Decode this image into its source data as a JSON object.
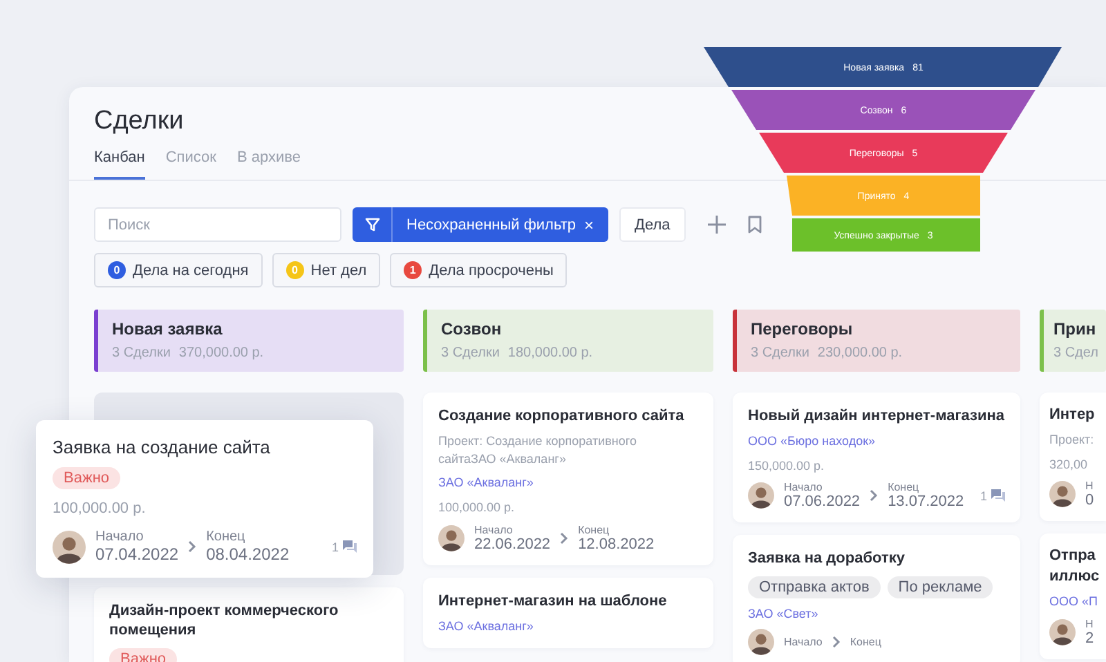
{
  "page": {
    "title": "Сделки"
  },
  "tabs": [
    {
      "label": "Канбан",
      "selected": true
    },
    {
      "label": "Список",
      "selected": false
    },
    {
      "label": "В архиве",
      "selected": false
    }
  ],
  "search": {
    "placeholder": "Поиск"
  },
  "filter": {
    "label": "Несохраненный фильтр",
    "clear": "×"
  },
  "tasks_button": "Дела",
  "chips": [
    {
      "count": "0",
      "label": "Дела на сегодня",
      "color": "#2f5ee0"
    },
    {
      "count": "0",
      "label": "Нет дел",
      "color": "#f5c518"
    },
    {
      "count": "1",
      "label": "Дела просрочены",
      "color": "#e8493f"
    }
  ],
  "funnel": [
    {
      "label": "Новая заявка",
      "count": "81",
      "color": "#2e4f8c"
    },
    {
      "label": "Созвон",
      "count": "6",
      "color": "#9a52b8"
    },
    {
      "label": "Переговоры",
      "count": "5",
      "color": "#e83a5a"
    },
    {
      "label": "Принято",
      "count": "4",
      "color": "#fbb225"
    },
    {
      "label": "Успешно закрытые",
      "count": "3",
      "color": "#6cc02a"
    }
  ],
  "columns": [
    {
      "title": "Новая заявка",
      "deals": "3 Сделки",
      "sum": "370,000.00 р.",
      "color": "#7a3fd0",
      "slot": true,
      "cards": [
        {
          "title": "Дизайн-проект коммерческого помещения",
          "tags": [
            {
              "label": "Важно",
              "kind": "alert"
            }
          ]
        }
      ]
    },
    {
      "title": "Созвон",
      "deals": "3 Сделки",
      "sum": "180,000.00 р.",
      "color": "#7cc04a",
      "cards": [
        {
          "title": "Создание корпоративного сайта",
          "project": "Проект: Создание корпоративного сайтаЗАО «Акваланг»",
          "company": "ЗАО «Акваланг»",
          "amount": "100,000.00 р.",
          "start_label": "Начало",
          "start": "22.06.2022",
          "end_label": "Конец",
          "end": "12.08.2022"
        },
        {
          "title": "Интернет-магазин на шаблоне",
          "company": "ЗАО «Акваланг»"
        }
      ]
    },
    {
      "title": "Переговоры",
      "deals": "3 Сделки",
      "sum": "230,000.00 р.",
      "color": "#c8323a",
      "cards": [
        {
          "title": "Новый дизайн интернет-магазина",
          "company": "ООО «Бюро находок»",
          "amount": "150,000.00 р.",
          "start_label": "Начало",
          "start": "07.06.2022",
          "end_label": "Конец",
          "end": "13.07.2022",
          "comments": "1"
        },
        {
          "title": "Заявка на доработку",
          "tags": [
            {
              "label": "Отправка актов",
              "kind": "plain"
            },
            {
              "label": "По рекламе",
              "kind": "plain"
            }
          ],
          "company": "ЗАО «Свет»",
          "start_label": "Начало",
          "end_label": "Конец"
        }
      ]
    },
    {
      "title": "Прин",
      "deals": "3 Сдел",
      "color": "#7cc04a",
      "cards": [
        {
          "title": "Интер",
          "project": "Проект:",
          "amount": "320,00",
          "start_label": "Н",
          "start": "0"
        },
        {
          "title": "Отпра иллюс",
          "company": "ООО «П",
          "start_label": "Н",
          "start": "2"
        }
      ]
    }
  ],
  "dragged_card": {
    "title": "Заявка на создание сайта",
    "tags": [
      {
        "label": "Важно",
        "kind": "alert"
      }
    ],
    "amount": "100,000.00 р.",
    "start_label": "Начало",
    "start": "07.04.2022",
    "end_label": "Конец",
    "end": "08.04.2022",
    "comments": "1"
  }
}
